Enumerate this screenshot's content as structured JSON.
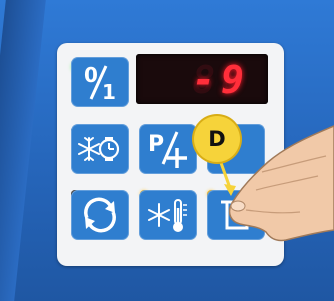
{
  "display": {
    "readout": "-9",
    "ghost": "88"
  },
  "callout": {
    "label": "D"
  },
  "buttons": [
    {
      "icon": "on-off-icon"
    },
    {
      "icon": "defrost-timer-icon"
    },
    {
      "icon": "program-add-icon"
    },
    {
      "icon": "cycle-icon"
    },
    {
      "icon": "thermometer-defrost-icon"
    },
    {
      "icon": "defrost-drip-icon"
    }
  ],
  "leds": {
    "on": "#3ad23a",
    "off": "#2a2a2a",
    "amber": "#e2b43a"
  },
  "colors": {
    "button": "#2f7ecf",
    "panel": "#f3f4f6",
    "callout": "#f6d33a",
    "background": "#2a6fc9"
  }
}
